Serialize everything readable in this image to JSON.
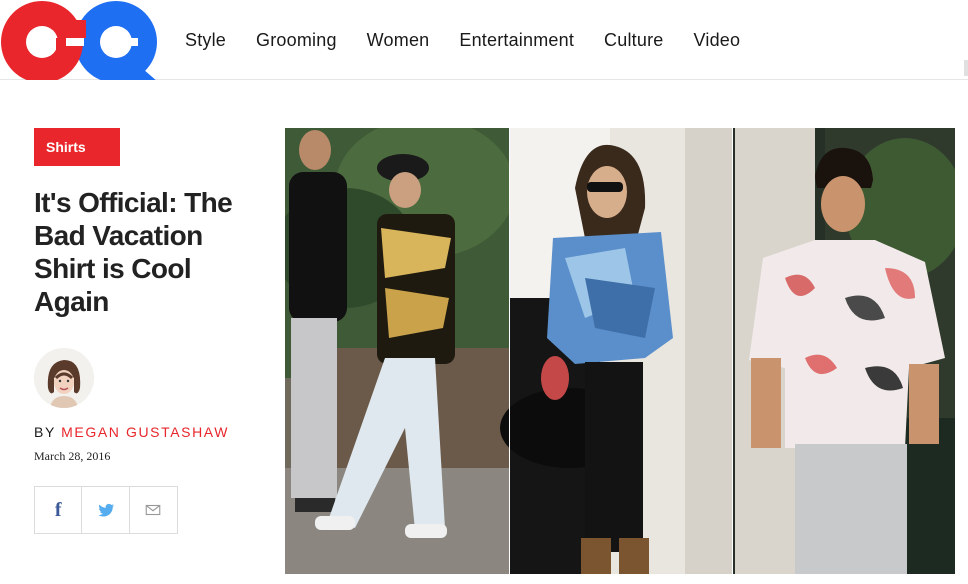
{
  "brand": {
    "logo_text": "GQ",
    "colors": {
      "red": "#e8262b",
      "blue": "#1f6ff2"
    }
  },
  "nav": {
    "items": [
      {
        "label": "Style"
      },
      {
        "label": "Grooming"
      },
      {
        "label": "Women"
      },
      {
        "label": "Entertainment"
      },
      {
        "label": "Culture"
      },
      {
        "label": "Video"
      }
    ]
  },
  "article": {
    "tag": "Shirts",
    "headline": "It's Official: The Bad Vacation Shirt is Cool Again",
    "byline_prefix": "BY",
    "author": "MEGAN GUSTASHAW",
    "date": "March 28, 2016",
    "share": {
      "facebook_icon": "facebook-icon",
      "twitter_icon": "twitter-icon",
      "email_icon": "email-icon"
    }
  }
}
